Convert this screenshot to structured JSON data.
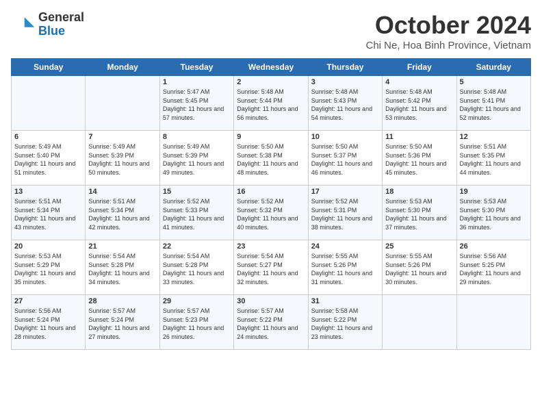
{
  "logo": {
    "general": "General",
    "blue": "Blue"
  },
  "title": "October 2024",
  "location": "Chi Ne, Hoa Binh Province, Vietnam",
  "days_of_week": [
    "Sunday",
    "Monday",
    "Tuesday",
    "Wednesday",
    "Thursday",
    "Friday",
    "Saturday"
  ],
  "weeks": [
    [
      {
        "day": "",
        "info": ""
      },
      {
        "day": "",
        "info": ""
      },
      {
        "day": "1",
        "info": "Sunrise: 5:47 AM\nSunset: 5:45 PM\nDaylight: 11 hours and 57 minutes."
      },
      {
        "day": "2",
        "info": "Sunrise: 5:48 AM\nSunset: 5:44 PM\nDaylight: 11 hours and 56 minutes."
      },
      {
        "day": "3",
        "info": "Sunrise: 5:48 AM\nSunset: 5:43 PM\nDaylight: 11 hours and 54 minutes."
      },
      {
        "day": "4",
        "info": "Sunrise: 5:48 AM\nSunset: 5:42 PM\nDaylight: 11 hours and 53 minutes."
      },
      {
        "day": "5",
        "info": "Sunrise: 5:48 AM\nSunset: 5:41 PM\nDaylight: 11 hours and 52 minutes."
      }
    ],
    [
      {
        "day": "6",
        "info": "Sunrise: 5:49 AM\nSunset: 5:40 PM\nDaylight: 11 hours and 51 minutes."
      },
      {
        "day": "7",
        "info": "Sunrise: 5:49 AM\nSunset: 5:39 PM\nDaylight: 11 hours and 50 minutes."
      },
      {
        "day": "8",
        "info": "Sunrise: 5:49 AM\nSunset: 5:39 PM\nDaylight: 11 hours and 49 minutes."
      },
      {
        "day": "9",
        "info": "Sunrise: 5:50 AM\nSunset: 5:38 PM\nDaylight: 11 hours and 48 minutes."
      },
      {
        "day": "10",
        "info": "Sunrise: 5:50 AM\nSunset: 5:37 PM\nDaylight: 11 hours and 46 minutes."
      },
      {
        "day": "11",
        "info": "Sunrise: 5:50 AM\nSunset: 5:36 PM\nDaylight: 11 hours and 45 minutes."
      },
      {
        "day": "12",
        "info": "Sunrise: 5:51 AM\nSunset: 5:35 PM\nDaylight: 11 hours and 44 minutes."
      }
    ],
    [
      {
        "day": "13",
        "info": "Sunrise: 5:51 AM\nSunset: 5:34 PM\nDaylight: 11 hours and 43 minutes."
      },
      {
        "day": "14",
        "info": "Sunrise: 5:51 AM\nSunset: 5:34 PM\nDaylight: 11 hours and 42 minutes."
      },
      {
        "day": "15",
        "info": "Sunrise: 5:52 AM\nSunset: 5:33 PM\nDaylight: 11 hours and 41 minutes."
      },
      {
        "day": "16",
        "info": "Sunrise: 5:52 AM\nSunset: 5:32 PM\nDaylight: 11 hours and 40 minutes."
      },
      {
        "day": "17",
        "info": "Sunrise: 5:52 AM\nSunset: 5:31 PM\nDaylight: 11 hours and 38 minutes."
      },
      {
        "day": "18",
        "info": "Sunrise: 5:53 AM\nSunset: 5:30 PM\nDaylight: 11 hours and 37 minutes."
      },
      {
        "day": "19",
        "info": "Sunrise: 5:53 AM\nSunset: 5:30 PM\nDaylight: 11 hours and 36 minutes."
      }
    ],
    [
      {
        "day": "20",
        "info": "Sunrise: 5:53 AM\nSunset: 5:29 PM\nDaylight: 11 hours and 35 minutes."
      },
      {
        "day": "21",
        "info": "Sunrise: 5:54 AM\nSunset: 5:28 PM\nDaylight: 11 hours and 34 minutes."
      },
      {
        "day": "22",
        "info": "Sunrise: 5:54 AM\nSunset: 5:28 PM\nDaylight: 11 hours and 33 minutes."
      },
      {
        "day": "23",
        "info": "Sunrise: 5:54 AM\nSunset: 5:27 PM\nDaylight: 11 hours and 32 minutes."
      },
      {
        "day": "24",
        "info": "Sunrise: 5:55 AM\nSunset: 5:26 PM\nDaylight: 11 hours and 31 minutes."
      },
      {
        "day": "25",
        "info": "Sunrise: 5:55 AM\nSunset: 5:26 PM\nDaylight: 11 hours and 30 minutes."
      },
      {
        "day": "26",
        "info": "Sunrise: 5:56 AM\nSunset: 5:25 PM\nDaylight: 11 hours and 29 minutes."
      }
    ],
    [
      {
        "day": "27",
        "info": "Sunrise: 5:56 AM\nSunset: 5:24 PM\nDaylight: 11 hours and 28 minutes."
      },
      {
        "day": "28",
        "info": "Sunrise: 5:57 AM\nSunset: 5:24 PM\nDaylight: 11 hours and 27 minutes."
      },
      {
        "day": "29",
        "info": "Sunrise: 5:57 AM\nSunset: 5:23 PM\nDaylight: 11 hours and 26 minutes."
      },
      {
        "day": "30",
        "info": "Sunrise: 5:57 AM\nSunset: 5:22 PM\nDaylight: 11 hours and 24 minutes."
      },
      {
        "day": "31",
        "info": "Sunrise: 5:58 AM\nSunset: 5:22 PM\nDaylight: 11 hours and 23 minutes."
      },
      {
        "day": "",
        "info": ""
      },
      {
        "day": "",
        "info": ""
      }
    ]
  ]
}
